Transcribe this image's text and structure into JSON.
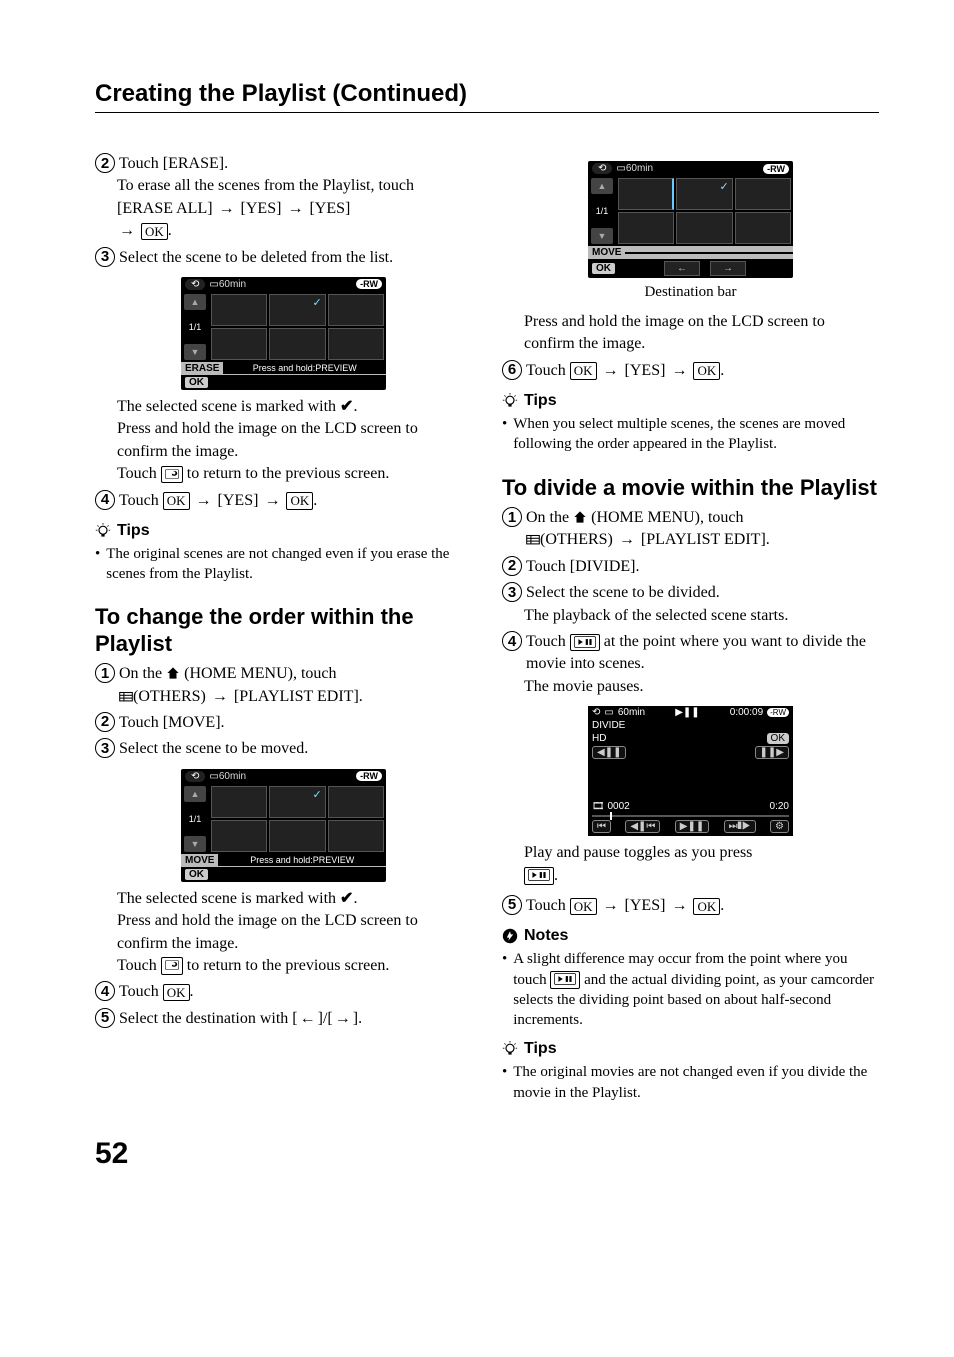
{
  "cont_title": "Creating the Playlist (Continued)",
  "page_number": "52",
  "left": {
    "s2": "Touch [ERASE].",
    "s2_a": "To erase all the scenes from the Playlist, touch [ERASE ALL] ",
    "s2_b": " [YES] ",
    "s2_c": " [YES] ",
    "s2_d": ".",
    "s3": "Select the scene to be deleted from the list.",
    "shot1": {
      "min": "60min",
      "pg": "1/1",
      "bar_lbl": "ERASE",
      "bar_hint": "Press and hold:PREVIEW",
      "ok": "OK",
      "rw": "-RW"
    },
    "after3_a": "The selected scene is marked with ",
    "after3_b": ".",
    "after3_c": "Press and hold the image on the LCD screen to confirm the image.",
    "after3_d1": "Touch ",
    "after3_d2": " to return to the previous screen.",
    "s4_a": "Touch ",
    "s4_b": " [YES] ",
    "s4_c": ".",
    "tips_lbl": "Tips",
    "tip1": "The original scenes are not changed even if you erase the scenes from the Playlist.",
    "h_change": "To change the order within the Playlist",
    "c1_a": "On the ",
    "c1_b": " (HOME MENU), touch ",
    "c1_c": "(OTHERS) ",
    "c1_d": " [PLAYLIST EDIT].",
    "c2": "Touch [MOVE].",
    "c3": "Select the scene to be moved.",
    "shot2": {
      "min": "60min",
      "pg": "1/1",
      "bar_lbl": "MOVE",
      "bar_hint": "Press and hold:PREVIEW",
      "ok": "OK",
      "rw": "-RW"
    },
    "afterc3_a": "The selected scene is marked with ",
    "afterc3_b": ".",
    "afterc3_c": "Press and hold the image on the LCD screen to confirm the image.",
    "afterc3_d1": "Touch ",
    "afterc3_d2": " to return to the previous screen.",
    "c4_a": "Touch ",
    "c4_b": ".",
    "c5_a": "Select the destination with [",
    "c5_b": "]/[",
    "c5_c": "]."
  },
  "right": {
    "shot3": {
      "min": "60min",
      "pg": "1/1",
      "bar_lbl": "MOVE",
      "ok": "OK",
      "rw": "-RW"
    },
    "dest_caption": "Destination bar",
    "r_after_a": "Press and hold the image on the LCD screen to confirm the image.",
    "r6_a": "Touch ",
    "r6_b": " [YES] ",
    "r6_c": ".",
    "tips_lbl": "Tips",
    "rtip1": "When you select multiple scenes, the scenes are moved following the order appeared in the Playlist.",
    "h_divide": "To divide a movie within the Playlist",
    "d1_a": "On the ",
    "d1_b": " (HOME MENU), touch ",
    "d1_c": "(OTHERS) ",
    "d1_d": " [PLAYLIST EDIT].",
    "d2": "Touch [DIVIDE].",
    "d3": "Select the scene to be divided.",
    "d3_b": "The playback of the selected scene starts.",
    "d4_a": "Touch ",
    "d4_b": " at the point where you want to divide the movie into scenes.",
    "d4_c": "The movie pauses.",
    "dshot": {
      "min": "60min",
      "title": "DIVIDE",
      "hd": "HD",
      "time": "0:00:09",
      "rw": "-RW",
      "ok": "OK",
      "idx": "0002",
      "dur": "0:20"
    },
    "d_after_a": "Play and pause toggles as you press ",
    "d_after_b": ".",
    "d5_a": "Touch ",
    "d5_b": " [YES] ",
    "d5_c": ".",
    "notes_lbl": "Notes",
    "note1_a": "A slight difference may occur from the point where you touch ",
    "note1_b": " and the actual dividing point, as your camcorder selects the dividing point based on about half-second increments.",
    "tips2_lbl": "Tips",
    "tip2": "The original movies are not changed even if you divide the movie in the Playlist."
  },
  "glyph": {
    "ok": "OK",
    "arrow_r": "→",
    "arrow_l": "←",
    "check": "✔",
    "play_pause": "▶ ❚❚"
  }
}
